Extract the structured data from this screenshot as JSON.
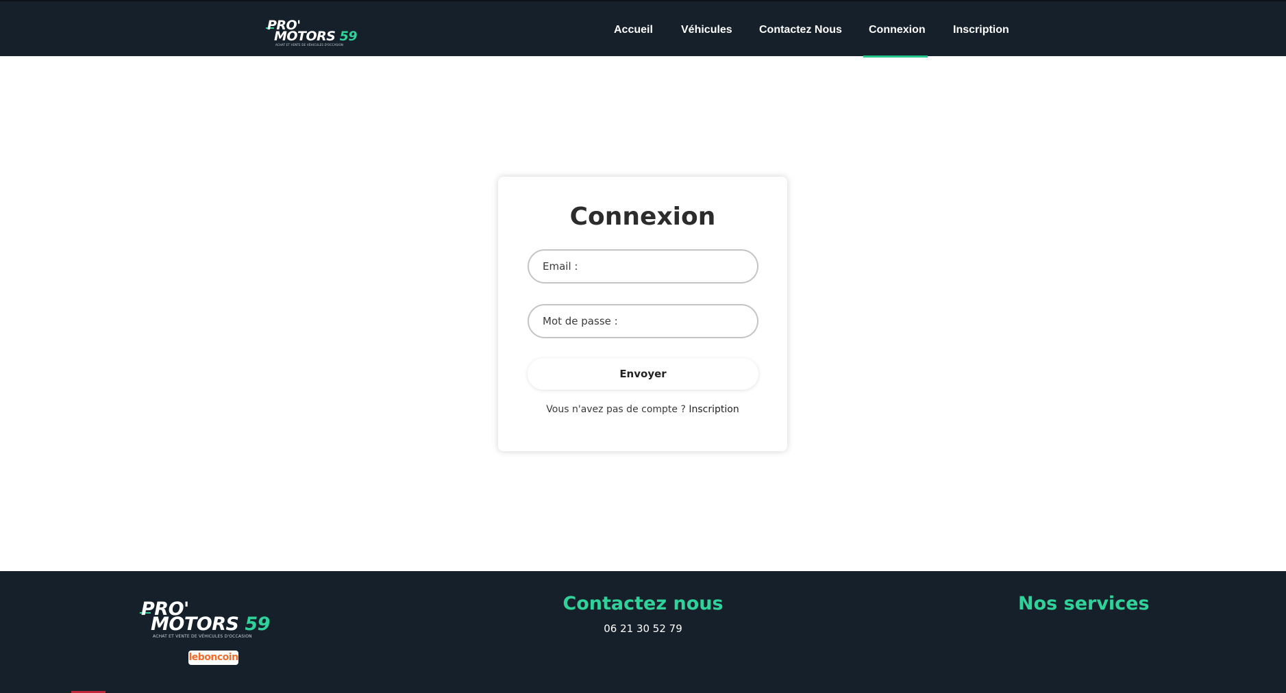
{
  "brand": {
    "logo_pro": "PRO'",
    "logo_motors": "MOTORS ",
    "logo_number": "59",
    "logo_tagline": "ACHAT ET VENTE DE VÉHICULES D'OCCASION"
  },
  "nav": {
    "items": [
      {
        "label": "Accueil"
      },
      {
        "label": "Véhicules"
      },
      {
        "label": "Contactez Nous"
      },
      {
        "label": "Connexion",
        "active": true
      },
      {
        "label": "Inscription"
      }
    ]
  },
  "login": {
    "title": "Connexion",
    "email_placeholder": "Email :",
    "email_value": "",
    "password_placeholder": "Mot de passe :",
    "password_value": "",
    "submit_label": "Envoyer",
    "signup_prompt": "Vous n'avez pas de compte ? ",
    "signup_link": "Inscription"
  },
  "footer": {
    "badge": "leboncoin",
    "contact_title": "Contactez nous",
    "phone": "06 21 30 52 79",
    "services_title": "Nos services"
  },
  "colors": {
    "navbar_bg": "#15202a",
    "accent": "#2fd39a",
    "footer_bg": "#16202a",
    "badge_text": "#f56b2a"
  }
}
